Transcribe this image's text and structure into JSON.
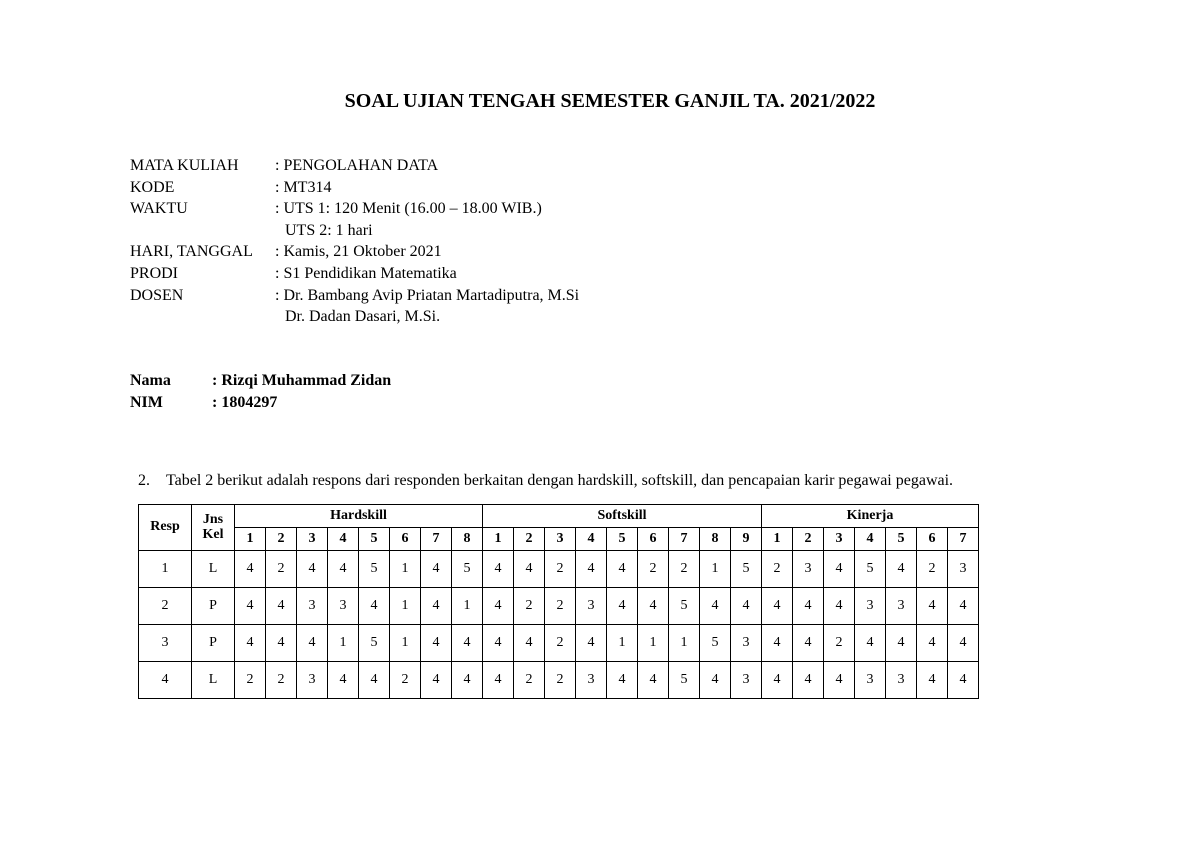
{
  "title": "SOAL UJIAN TENGAH SEMESTER GANJIL TA. 2021/2022",
  "info": {
    "mata_kuliah_label": "MATA KULIAH",
    "mata_kuliah_value": ": PENGOLAHAN DATA",
    "kode_label": "KODE",
    "kode_value": ": MT314",
    "waktu_label": "WAKTU",
    "waktu_value1": ": UTS 1: 120 Menit (16.00 – 18.00 WIB.)",
    "waktu_value2": "UTS 2: 1 hari",
    "hari_label": "HARI, TANGGAL",
    "hari_value": ": Kamis, 21 Oktober 2021",
    "prodi_label": "PRODI",
    "prodi_value": ": S1 Pendidikan Matematika",
    "dosen_label": "DOSEN",
    "dosen_value1": ": Dr. Bambang Avip Priatan Martadiputra, M.Si",
    "dosen_value2": "Dr. Dadan Dasari, M.Si."
  },
  "identity": {
    "nama_label": "Nama",
    "nama_value": ": Rizqi Muhammad Zidan",
    "nim_label": "NIM",
    "nim_value": ": 1804297"
  },
  "question": {
    "number": "2.",
    "text": "Tabel 2 berikut adalah respons dari responden berkaitan dengan hardskill, softskill, dan pencapaian karir pegawai pegawai."
  },
  "chart_data": {
    "type": "table",
    "headers": {
      "resp": "Resp",
      "jns_kel_line1": "Jns",
      "jns_kel_line2": "Kel",
      "hardskill": "Hardskill",
      "softskill": "Softskill",
      "kinerja": "Kinerja",
      "hard_cols": [
        "1",
        "2",
        "3",
        "4",
        "5",
        "6",
        "7",
        "8"
      ],
      "soft_cols": [
        "1",
        "2",
        "3",
        "4",
        "5",
        "6",
        "7",
        "8",
        "9"
      ],
      "kin_cols": [
        "1",
        "2",
        "3",
        "4",
        "5",
        "6",
        "7"
      ]
    },
    "rows": [
      {
        "resp": "1",
        "jns": "L",
        "hard": [
          4,
          2,
          4,
          4,
          5,
          1,
          4,
          5
        ],
        "soft": [
          4,
          4,
          2,
          4,
          4,
          2,
          2,
          1,
          5
        ],
        "kin": [
          2,
          3,
          4,
          5,
          4,
          2,
          3
        ]
      },
      {
        "resp": "2",
        "jns": "P",
        "hard": [
          4,
          4,
          3,
          3,
          4,
          1,
          4,
          1
        ],
        "soft": [
          4,
          2,
          2,
          3,
          4,
          4,
          5,
          4,
          4
        ],
        "kin": [
          4,
          4,
          4,
          3,
          3,
          4,
          4
        ]
      },
      {
        "resp": "3",
        "jns": "P",
        "hard": [
          4,
          4,
          4,
          1,
          5,
          1,
          4,
          4
        ],
        "soft": [
          4,
          4,
          2,
          4,
          1,
          1,
          1,
          5,
          3
        ],
        "kin": [
          4,
          4,
          2,
          4,
          4,
          4,
          4
        ]
      },
      {
        "resp": "4",
        "jns": "L",
        "hard": [
          2,
          2,
          3,
          4,
          4,
          2,
          4,
          4
        ],
        "soft": [
          4,
          2,
          2,
          3,
          4,
          4,
          5,
          4,
          3
        ],
        "kin": [
          4,
          4,
          4,
          3,
          3,
          4,
          4
        ]
      }
    ]
  }
}
